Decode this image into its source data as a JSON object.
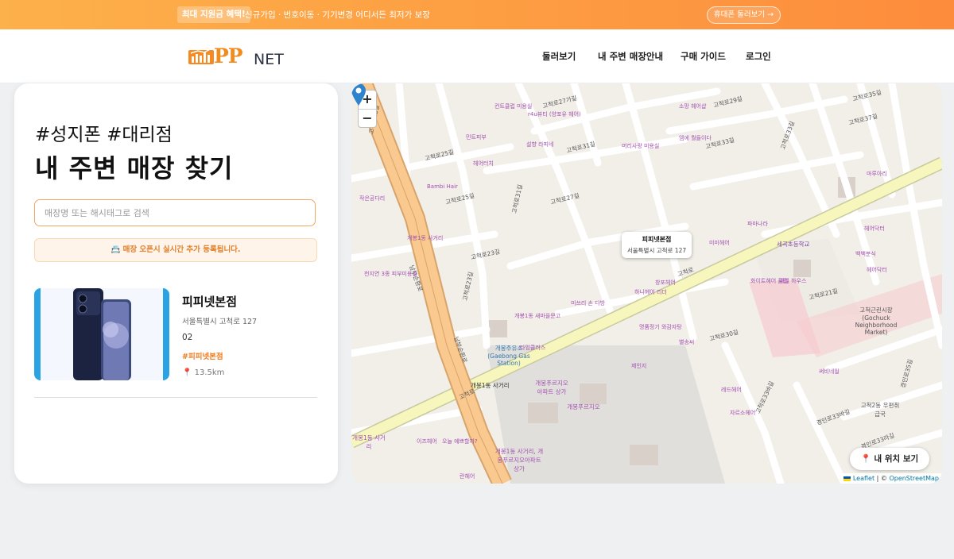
{
  "promo": {
    "badge": "최대 지원금 혜택!",
    "text": "신규가입 · 번호이동 · 기기변경 어디서든 최저가 보장",
    "button": "휴대폰 둘러보기 →"
  },
  "header": {
    "logo_main": "PP",
    "logo_sub": "NET",
    "nav": [
      "둘러보기",
      "내 주변 매장안내",
      "구매 가이드",
      "로그인"
    ]
  },
  "panel": {
    "hashtags": "#성지폰 #대리점",
    "title": "내 주변 매장 찾기",
    "search_placeholder": "매장명 또는 해시태그로 검색",
    "notice": "📇 매장 오픈시 실시간 추가 등록됩니다."
  },
  "store": {
    "name": "피피넷본점",
    "address": "서울특별시 고척로 127",
    "extra": "02",
    "tag": "#피피넷본점",
    "distance": "📍 13.5km"
  },
  "map": {
    "zoom_in": "+",
    "zoom_out": "−",
    "popup_title": "피피넷본점",
    "popup_address": "서울특별시 고척로 127",
    "locate_button": "📍 내 위치 보기",
    "attribution_leaflet": "Leaflet",
    "attribution_sep": " | © ",
    "attribution_osm": "OpenStreetMap",
    "street_labels": [
      "고척로",
      "고척로",
      "고척로23길",
      "고척로25길",
      "고척로27길",
      "고척로31길",
      "고척로33길",
      "고척로33바길",
      "고척로30길",
      "고척로29길",
      "고척로21길",
      "고척로27가길",
      "고척로37길",
      "고척로35길",
      "고척로31길",
      "고척로33길",
      "남부순환로",
      "남부순환로",
      "경인로33바길",
      "경인로33라길",
      "경인로35길",
      "고척로25길",
      "고척로25길",
      "고척로23길"
    ],
    "places": [
      "세곡초등학교",
      "개봉1동 사거리",
      "개봉주유소 (Gaebong Gas Station)",
      "고척근린시장 (Gochuck Neighborhood Market)",
      "고척2동 우편취급국",
      "개봉푸르지오",
      "개봉1동 사거리",
      "개봉1동 사거리, 개봉푸르지오아파트 상가",
      "개봉푸르지오아파트 상가"
    ],
    "pois": [
      "컨트클럽 미용실",
      "r4u뷰티 (양포유 헤어)",
      "설향 라피네",
      "헤어터치",
      "Bambi Hair",
      "작은공다리",
      "소망 헤어샵",
      "엠에 뭘들이다",
      "머리사랑 미용실",
      "파마나라",
      "마루아리",
      "헤어닥터",
      "백백분식",
      "미미헤어",
      "헤어닥터",
      "창포헤어",
      "하니헤어 리더",
      "미쓰리 손 다방",
      "개봉1동 새마을문고",
      "타임클러스",
      "명품정기 와감자탕",
      "별송씨",
      "제인지",
      "레드헤어",
      "자르소헤어",
      "써비네일",
      "천지연 3종 피부미용실",
      "화이트헤어 클럽",
      "네일 하우스",
      "이즈헤어",
      "오늘 예쁘할까?",
      "란헤어",
      "개봉1동 사거리",
      "민트피부"
    ]
  }
}
